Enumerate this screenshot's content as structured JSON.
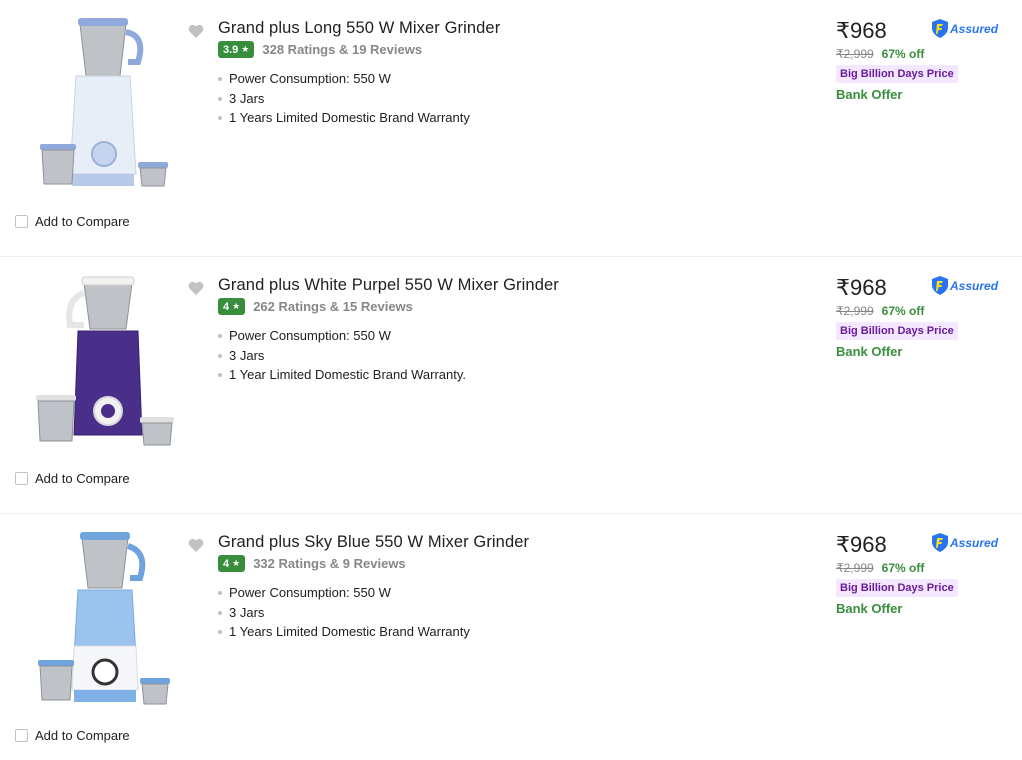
{
  "products": [
    {
      "title": "Grand plus Long 550 W Mixer Grinder",
      "rating": "3.9",
      "rating_count": "328 Ratings & 19 Reviews",
      "specs": [
        "Power Consumption: 550 W",
        "3 Jars",
        "1 Years Limited Domestic Brand Warranty"
      ],
      "price": "₹968",
      "mrp": "₹2,999",
      "discount": "67% off",
      "deal": "Big Billion Days Price",
      "bank_offer": "Bank Offer",
      "assured": "Assured",
      "compare_label": "Add to Compare",
      "body_color": "#e8eef8",
      "accent_color": "#8fa9dc"
    },
    {
      "title": "Grand plus White Purpel 550 W Mixer Grinder",
      "rating": "4",
      "rating_count": "262 Ratings & 15 Reviews",
      "specs": [
        "Power Consumption: 550 W",
        "3 Jars",
        "1 Year Limited Domestic Brand Warranty."
      ],
      "price": "₹968",
      "mrp": "₹2,999",
      "discount": "67% off",
      "deal": "Big Billion Days Price",
      "bank_offer": "Bank Offer",
      "assured": "Assured",
      "compare_label": "Add to Compare",
      "body_color": "#4a2f8a",
      "accent_color": "#f2f2f2"
    },
    {
      "title": "Grand plus Sky Blue 550 W Mixer Grinder",
      "rating": "4",
      "rating_count": "332 Ratings & 9 Reviews",
      "specs": [
        "Power Consumption: 550 W",
        "3 Jars",
        "1 Years Limited Domestic Brand Warranty"
      ],
      "price": "₹968",
      "mrp": "₹2,999",
      "discount": "67% off",
      "deal": "Big Billion Days Price",
      "bank_offer": "Bank Offer",
      "assured": "Assured",
      "compare_label": "Add to Compare",
      "body_color": "#9cc3ee",
      "accent_color": "#6fa3dd"
    }
  ],
  "colors": {
    "rating_green": "#388e3c",
    "discount_green": "#388e3c",
    "deal_purple": "#6a1b9a",
    "assured_blue": "#2874f0"
  }
}
